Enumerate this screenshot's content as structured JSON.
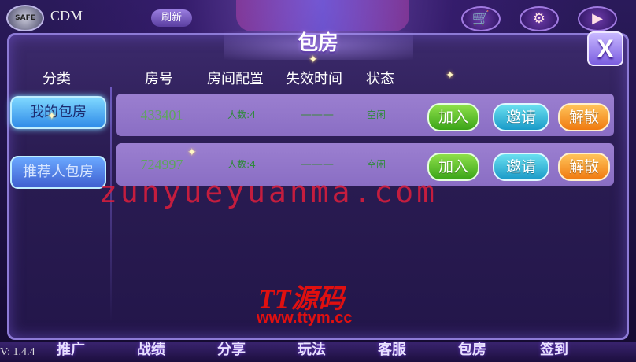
{
  "top_bar": {
    "avatar_text": "SAFE",
    "username": "CDM",
    "refresh_label": "刷新",
    "circle_icons": [
      "cart-icon",
      "gear-icon",
      "play-icon"
    ]
  },
  "dialog": {
    "title": "包房",
    "close_label": "X",
    "headers": {
      "category": "分类",
      "room_no": "房号",
      "room_config": "房间配置",
      "expire_time": "失效时间",
      "status": "状态"
    },
    "sidebar": [
      {
        "label": "我的包房",
        "active": true
      },
      {
        "label": "推荐人包房",
        "active": false
      }
    ],
    "rooms": [
      {
        "id": "433401",
        "config": "人数:4",
        "expire": "———",
        "status": "空闲"
      },
      {
        "id": "724997",
        "config": "人数:4",
        "expire": "———",
        "status": "空闲"
      }
    ],
    "row_buttons": {
      "join": "加入",
      "invite": "邀请",
      "dismiss": "解散"
    }
  },
  "bottom_bar": {
    "version": "V: 1.4.4",
    "tabs": [
      "推广",
      "战绩",
      "分享",
      "玩法",
      "客服",
      "包房",
      "签到"
    ]
  },
  "watermark": {
    "url_big": "zunyueyuanma.com",
    "brand": "TT源码",
    "url_small": "www.ttym.cc"
  },
  "colors": {
    "dialog_bg": "#2a1c52",
    "row_bg": "#9b7fd0",
    "join": "#3aa418",
    "invite": "#1a9ac8",
    "dismiss": "#f07a10",
    "watermark": "#e01010"
  }
}
